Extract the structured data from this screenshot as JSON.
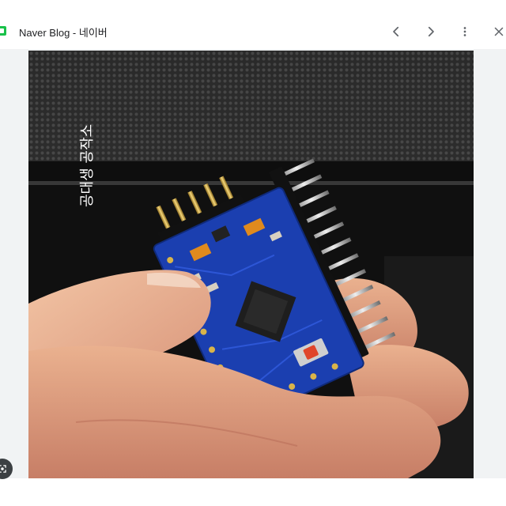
{
  "window": {
    "title": "Naver Blog - 네이버",
    "favicon": "naver-blog-icon",
    "accent": "#19c14a"
  },
  "toolbar": {
    "back_icon": "chevron-left-icon",
    "forward_icon": "chevron-right-icon",
    "more_icon": "more-vertical-icon",
    "close_icon": "close-icon"
  },
  "image": {
    "subject": "arduino-pro-mini-board",
    "watermark": "공대생 공작소",
    "board_color": "#1b3fb0"
  },
  "overlay": {
    "icon": "lens-icon"
  }
}
